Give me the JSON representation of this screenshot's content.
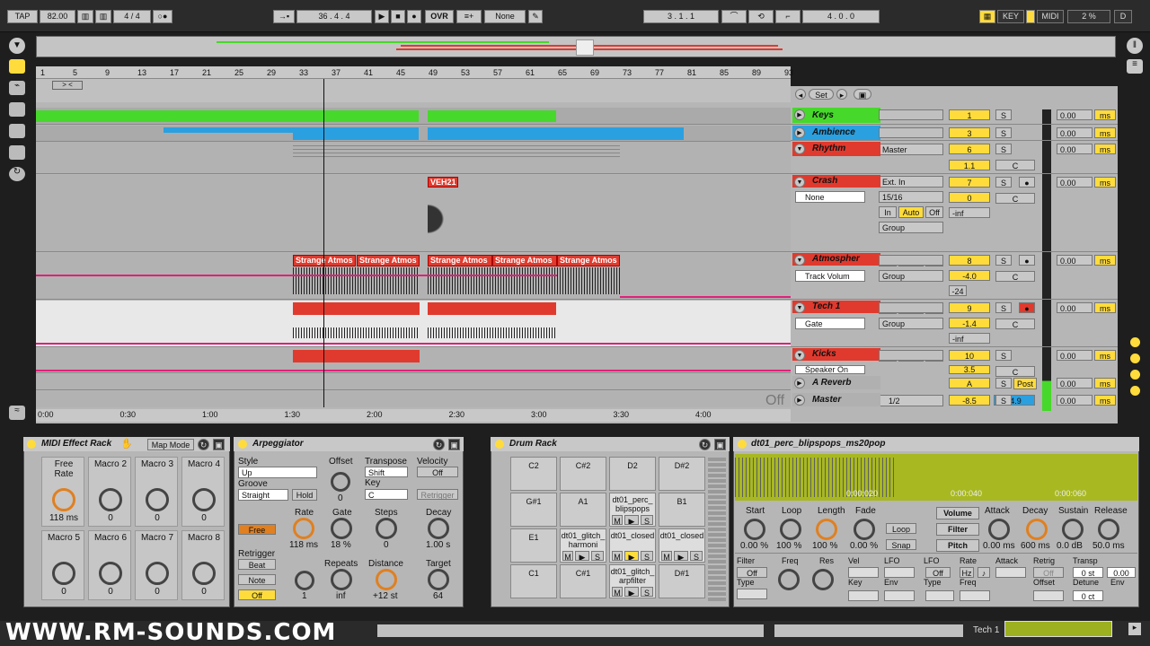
{
  "transport": {
    "tap": "TAP",
    "tempo": "82.00",
    "signature": "4 / 4",
    "position": "36 .  4 .  4",
    "ovr": "OVR",
    "quantize": "None",
    "loop_start": "3 .  1 .  1",
    "loop_length": "4 .  0 .  0",
    "key": "KEY",
    "midi": "MIDI",
    "cpu": "2 %",
    "d": "D"
  },
  "ruler_bars": [
    "1",
    "5",
    "9",
    "13",
    "17",
    "21",
    "25",
    "29",
    "33",
    "37",
    "41",
    "45",
    "49",
    "53",
    "57",
    "61",
    "65",
    "69",
    "73",
    "77",
    "81",
    "85",
    "89",
    "93"
  ],
  "time_ticks": [
    "0:00",
    "0:30",
    "1:00",
    "1:30",
    "2:00",
    "2:30",
    "3:00",
    "3:30",
    "4:00"
  ],
  "set_label": "Set",
  "tracks": [
    {
      "name": "Keys",
      "color": "#46d82a",
      "num": "1"
    },
    {
      "name": "Ambience",
      "color": "#2aa0e0",
      "num": "3"
    },
    {
      "name": "Rhythm",
      "color": "#e03a2e",
      "num": "6"
    },
    {
      "name": "Crash",
      "color": "#e03a2e",
      "num": "7"
    },
    {
      "name": "Atmospher",
      "color": "#e03a2e",
      "num": "8"
    },
    {
      "name": "Tech 1",
      "color": "#e03a2e",
      "num": "9"
    },
    {
      "name": "Kicks",
      "color": "#e03a2e",
      "num": "10"
    },
    {
      "name": "A Reverb",
      "color": "#b0b0b0",
      "num": "A"
    },
    {
      "name": "Master",
      "color": "#b0b0b0",
      "num": ""
    }
  ],
  "mixer": {
    "master_route": "Master",
    "ext_in": "Ext. In",
    "none": "None",
    "ratio": "15/16",
    "group": "Group",
    "track_volume": "Track Volum",
    "gate": "Gate",
    "speaker": "Speaker On",
    "in": "In",
    "auto": "Auto",
    "off": "Off",
    "s": "S",
    "c": "C",
    "post": "Post",
    "half": "1/2",
    "zero_ms": "0.00",
    "ms": "ms",
    "vals": {
      "rhythm": "1.1",
      "crash": "0",
      "crash_inf": "-inf",
      "atm": "-4.0",
      "atm2": "-24",
      "tech": "-1.4",
      "tech_inf": "-inf",
      "kicks": "3.5",
      "master": "-8.5",
      "master2": "-4.9"
    }
  },
  "clips": {
    "veh": "VEH21",
    "strange": "Strange Atmos"
  },
  "off_label": "Off",
  "devices": {
    "midi_rack": {
      "title": "MIDI Effect Rack",
      "map": "Map Mode",
      "macros": [
        {
          "name": "Free Rate",
          "val": "118 ms"
        },
        {
          "name": "Macro 2",
          "val": "0"
        },
        {
          "name": "Macro 3",
          "val": "0"
        },
        {
          "name": "Macro 4",
          "val": "0"
        },
        {
          "name": "Macro 5",
          "val": "0"
        },
        {
          "name": "Macro 6",
          "val": "0"
        },
        {
          "name": "Macro 7",
          "val": "0"
        },
        {
          "name": "Macro 8",
          "val": "0"
        }
      ]
    },
    "arp": {
      "title": "Arpeggiator",
      "style": "Style",
      "style_val": "Up",
      "groove": "Groove",
      "groove_val": "Straight",
      "hold": "Hold",
      "offset": "Offset",
      "offset_val": "0",
      "transpose": "Transpose",
      "transpose_val": "Shift",
      "key": "Key",
      "key_val": "C",
      "velocity": "Velocity",
      "vel_val": "Off",
      "retrigger_btn": "Retrigger",
      "free": "Free",
      "rate": "Rate",
      "rate_val": "118 ms",
      "gate": "Gate",
      "gate_val": "18 %",
      "steps": "Steps",
      "steps_val": "0",
      "decay": "Decay",
      "decay_val": "1.00 s",
      "retrigger": "Retrigger",
      "beat": "Beat",
      "note": "Note",
      "off": "Off",
      "repeats": "Repeats",
      "repeats_val": "inf",
      "distance": "Distance",
      "distance_val": "+12 st",
      "target": "Target",
      "target_val": "64",
      "one": "1"
    },
    "drum": {
      "title": "Drum Rack",
      "pads": [
        "C2",
        "C#2",
        "D2",
        "D#2",
        "G#1",
        "A1",
        "dt01_perc_blipspops",
        "B1",
        "E1",
        "dt01_glitch_harmoni",
        "dt01_closed",
        "dt01_closed",
        "C1",
        "C#1",
        "dt01_glitch_arpfilter",
        "D#1"
      ],
      "m": "M",
      "s": "S"
    },
    "sampler": {
      "title": "dt01_perc_blipspops_ms20pop",
      "t1": "0:00:020",
      "t2": "0:00:040",
      "t3": "0:00:060",
      "start": "Start",
      "start_val": "0.00 %",
      "loop": "Loop",
      "loop_val": "100 %",
      "length": "Length",
      "length_val": "100 %",
      "fade": "Fade",
      "fade_val": "0.00 %",
      "loop_btn": "Loop",
      "snap": "Snap",
      "volume": "Volume",
      "filter": "Filter",
      "pitch": "Pitch",
      "attack": "Attack",
      "attack_val": "0.00 ms",
      "decay": "Decay",
      "decay_val": "600 ms",
      "sustain": "Sustain",
      "sustain_val": "0.0 dB",
      "release": "Release",
      "release_val": "50.0 ms",
      "filter2": "Filter",
      "freq": "Freq",
      "res": "Res",
      "vel": "Vel",
      "lfo": "LFO",
      "type": "Type",
      "key": "Key",
      "env": "Env",
      "lfo2": "LFO",
      "rate": "Rate",
      "hz": "Hz",
      "attack2": "Attack",
      "retrig": "Retrig",
      "transp": "Transp",
      "transp_val": "0 st",
      "detune": "Detune",
      "detune_val": "0 ct",
      "offset": "Offset",
      "env2": "Env",
      "off": "Off",
      "pct": "0.00"
    }
  },
  "status": {
    "watermark": "WWW.RM-SOUNDS.COM",
    "track": "Tech 1"
  }
}
